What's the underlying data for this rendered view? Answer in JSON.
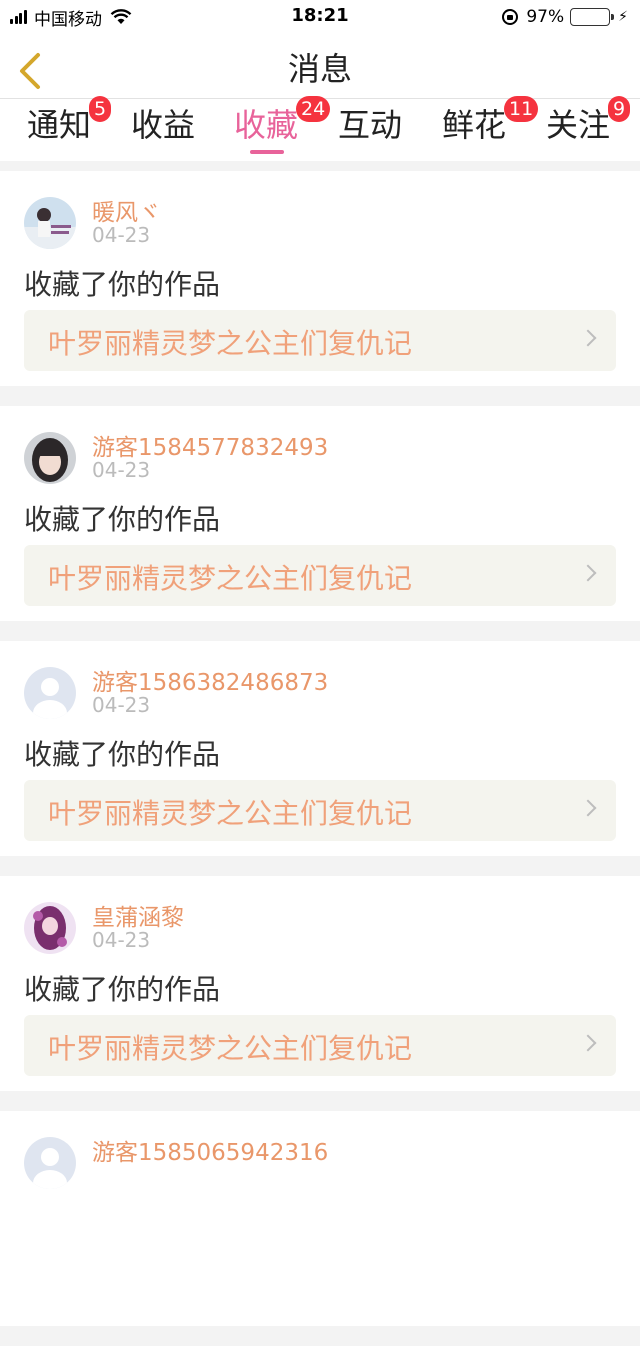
{
  "status_bar": {
    "carrier": "中国移动",
    "time": "18:21",
    "battery_percent": "97%",
    "battery_level": 0.97,
    "icons": [
      "signal-icon",
      "wifi-icon",
      "orientation-lock-icon",
      "battery-icon",
      "charging-icon"
    ]
  },
  "nav": {
    "title": "消息",
    "back_icon": "chevron-left-icon",
    "accent_color": "#e8639a"
  },
  "tabs": [
    {
      "label": "通知",
      "badge": "5"
    },
    {
      "label": "收益",
      "badge": ""
    },
    {
      "label": "收藏",
      "badge": "24",
      "active": true
    },
    {
      "label": "互动",
      "badge": ""
    },
    {
      "label": "鲜花",
      "badge": "11"
    },
    {
      "label": "关注",
      "badge": "9"
    }
  ],
  "feed": [
    {
      "username": "暖风ヾ",
      "date": "04-23",
      "action": "收藏了你的作品",
      "work_title": "叶罗丽精灵梦之公主们复仇记",
      "avatar": "photo-avatar-girl-sea"
    },
    {
      "username": "游客1584577832493",
      "date": "04-23",
      "action": "收藏了你的作品",
      "work_title": "叶罗丽精灵梦之公主们复仇记",
      "avatar": "photo-avatar-girl-portrait"
    },
    {
      "username": "游客1586382486873",
      "date": "04-23",
      "action": "收藏了你的作品",
      "work_title": "叶罗丽精灵梦之公主们复仇记",
      "avatar": "default-user-avatar"
    },
    {
      "username": "皇蒲涵黎",
      "date": "04-23",
      "action": "收藏了你的作品",
      "work_title": "叶罗丽精灵梦之公主们复仇记",
      "avatar": "anime-avatar-purple"
    },
    {
      "username": "游客1585065942316",
      "date": "",
      "action": "",
      "work_title": "",
      "avatar": "default-user-avatar"
    }
  ]
}
